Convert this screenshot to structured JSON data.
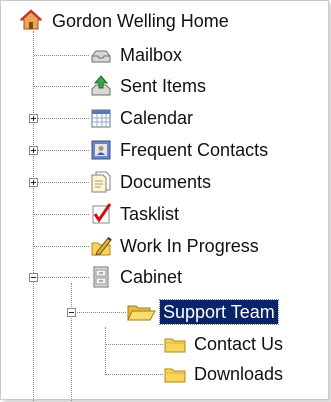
{
  "tree": {
    "root": {
      "label": "Gordon Welling Home",
      "icon": "home-icon"
    },
    "items": [
      {
        "label": "Mailbox",
        "icon": "mailbox-icon",
        "expander": "none"
      },
      {
        "label": "Sent Items",
        "icon": "sent-items-icon",
        "expander": "none"
      },
      {
        "label": "Calendar",
        "icon": "calendar-icon",
        "expander": "plus"
      },
      {
        "label": "Frequent Contacts",
        "icon": "contacts-icon",
        "expander": "plus"
      },
      {
        "label": "Documents",
        "icon": "documents-icon",
        "expander": "plus"
      },
      {
        "label": "Tasklist",
        "icon": "tasklist-icon",
        "expander": "none"
      },
      {
        "label": "Work In Progress",
        "icon": "work-in-progress-icon",
        "expander": "none"
      },
      {
        "label": "Cabinet",
        "icon": "cabinet-icon",
        "expander": "minus"
      }
    ],
    "cabinet_children": [
      {
        "label": "Support Team",
        "icon": "folder-open-icon",
        "expander": "minus",
        "selected": true
      }
    ],
    "support_team_children": [
      {
        "label": "Contact Us",
        "icon": "folder-icon"
      },
      {
        "label": "Downloads",
        "icon": "folder-icon"
      }
    ]
  },
  "colors": {
    "selection_bg": "#0a246a",
    "folder_yellow": "#f7d35a",
    "tree_line": "#8c8c8c"
  }
}
